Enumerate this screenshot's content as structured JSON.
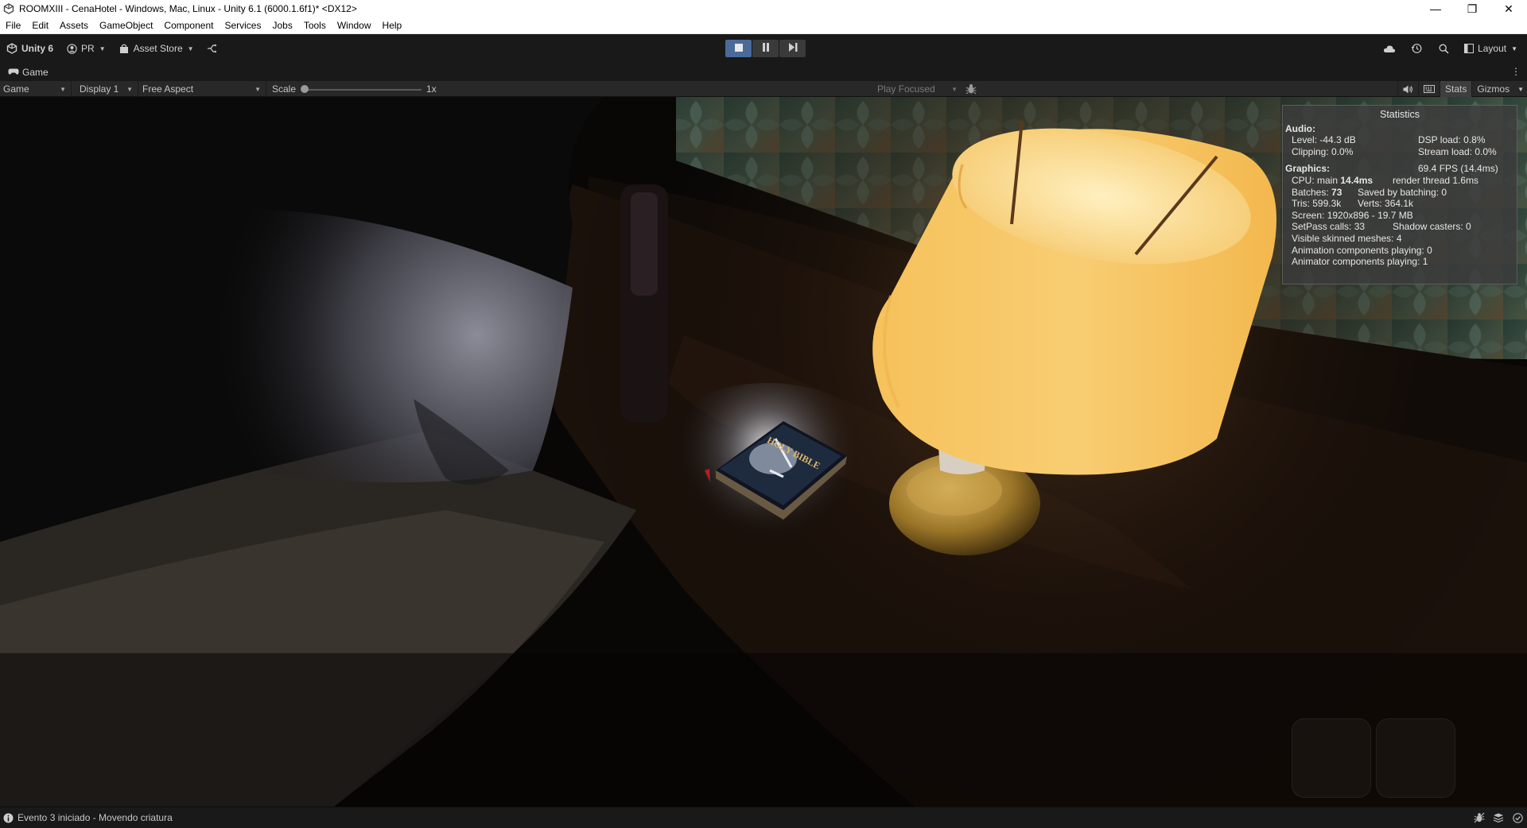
{
  "window": {
    "title": "ROOMXIII - CenaHotel - Windows, Mac, Linux - Unity 6.1 (6000.1.6f1)* <DX12>",
    "minimize": "—",
    "restore": "❐",
    "close": "✕"
  },
  "menu": [
    "File",
    "Edit",
    "Assets",
    "GameObject",
    "Component",
    "Services",
    "Jobs",
    "Tools",
    "Window",
    "Help"
  ],
  "toolbar": {
    "unity_label": "Unity 6",
    "account_label": "PR",
    "asset_store_label": "Asset Store",
    "layout_label": "Layout",
    "play_state": "playing",
    "accent_color": "#4a6b99"
  },
  "tab": {
    "label": "Game"
  },
  "game_toolbar": {
    "view_mode": "Game",
    "display": "Display 1",
    "aspect": "Free Aspect",
    "scale_label": "Scale",
    "scale_value": "1x",
    "scale_fraction": 0.0,
    "play_mode": "Play Focused",
    "stats_label": "Stats",
    "gizmos_label": "Gizmos"
  },
  "stats": {
    "title": "Statistics",
    "audio_header": "Audio:",
    "level": "Level: -44.3 dB",
    "dsp_load": "DSP load: 0.8%",
    "clipping": "Clipping: 0.0%",
    "stream_load": "Stream load: 0.0%",
    "graphics_header": "Graphics:",
    "fps": "69.4 FPS (14.4ms)",
    "cpu_prefix": "CPU: main",
    "cpu_main": "14.4ms",
    "render_thread": "render thread 1.6ms",
    "batches_prefix": "Batches:",
    "batches": "73",
    "saved_by_batching": "Saved by batching: 0",
    "tris": "Tris: 599.3k",
    "verts": "Verts: 364.1k",
    "screen": "Screen: 1920x896 - 19.7 MB",
    "setpass": "SetPass calls: 33",
    "shadow_casters": "Shadow casters: 0",
    "skinned_meshes": "Visible skinned meshes: 4",
    "animation_components": "Animation components playing: 0",
    "animator_components": "Animator components playing: 1"
  },
  "scene": {
    "book_title": "HOLY BIBLE",
    "lamp_color": "#f7c768",
    "wallpaper_color": "#2f4a40"
  },
  "status": {
    "message": "Evento 3 iniciado - Movendo criatura"
  }
}
